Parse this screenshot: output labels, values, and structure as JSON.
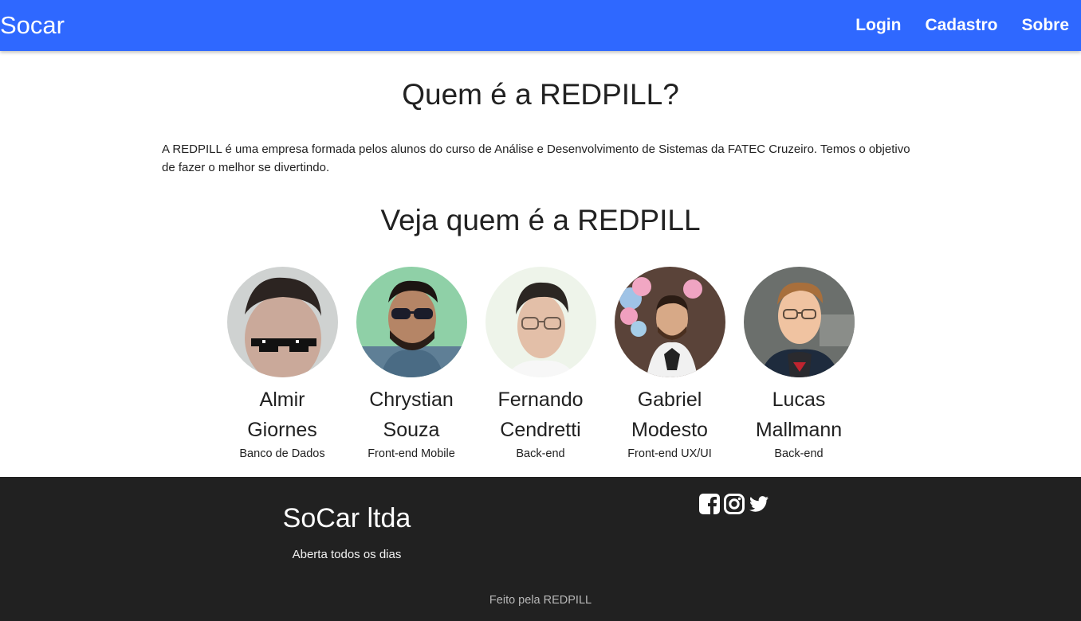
{
  "navbar": {
    "brand": "Socar",
    "links": [
      {
        "label": "Login"
      },
      {
        "label": "Cadastro"
      },
      {
        "label": "Sobre"
      }
    ]
  },
  "about": {
    "title": "Quem é a REDPILL?",
    "text": "A REDPILL é uma empresa formada pelos alunos do curso de Análise e Desenvolvimento de Sistemas da FATEC Cruzeiro. Temos o objetivo de fazer o melhor se divertindo."
  },
  "team": {
    "title": "Veja quem é a REDPILL",
    "members": [
      {
        "name": "Almir Giornes",
        "role": "Banco de Dados"
      },
      {
        "name": "Chrystian Souza",
        "role": "Front-end Mobile"
      },
      {
        "name": "Fernando Cendretti",
        "role": "Back-end"
      },
      {
        "name": "Gabriel Modesto",
        "role": "Front-end UX/UI"
      },
      {
        "name": "Lucas Mallmann",
        "role": "Back-end"
      }
    ]
  },
  "footer": {
    "title": "SoCar ltda",
    "subtitle": "Aberta todos os dias",
    "social": [
      "facebook-icon",
      "instagram-icon",
      "twitter-icon"
    ],
    "copyright": "Feito pela REDPILL"
  },
  "colors": {
    "navbar": "#2f68ff",
    "footer": "#212121"
  }
}
